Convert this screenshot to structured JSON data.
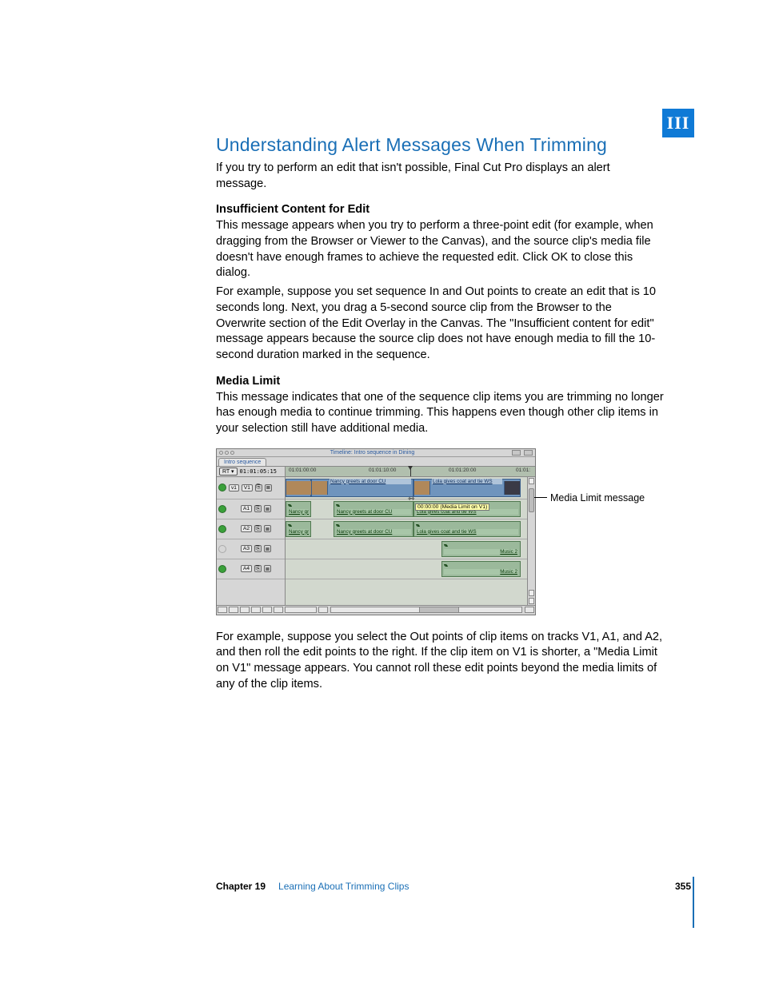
{
  "part_label": "III",
  "heading": "Understanding Alert Messages When Trimming",
  "intro": "If you try to perform an edit that isn't possible, Final Cut Pro displays an alert message.",
  "sub1_title": "Insufficient Content for Edit",
  "sub1_p1": "This message appears when you try to perform a three-point edit (for example, when dragging from the Browser or Viewer to the Canvas), and the source clip's media file doesn't have enough frames to achieve the requested edit. Click OK to close this dialog.",
  "sub1_p2": "For example, suppose you set sequence In and Out points to create an edit that is 10 seconds long. Next, you drag a 5-second source clip from the Browser to the Overwrite section of the Edit Overlay in the Canvas. The \"Insufficient content for edit\" message appears because the source clip does not have enough media to fill the 10-second duration marked in the sequence.",
  "sub2_title": "Media Limit",
  "sub2_p1": "This message indicates that one of the sequence clip items you are trimming no longer has enough media to continue trimming. This happens even though other clip items in your selection still have additional media.",
  "sub2_p2": "For example, suppose you select the Out points of clip items on tracks V1, A1, and A2, and then roll the edit points to the right. If the clip item on V1 is shorter, a \"Media Limit on V1\" message appears. You cannot roll these edit points beyond the media limits of any of the clip items.",
  "callout": "Media Limit message",
  "timeline": {
    "window_title": "Timeline: Intro sequence in Dining",
    "tab": "Intro sequence",
    "rt_label": "RT ▾",
    "timecode": "01:01:05:15",
    "ruler": {
      "t1": "01:01:00:00",
      "t2": "01:01:10:00",
      "t3": "01:01:20:00",
      "t4": "01:01:"
    },
    "tracks": {
      "v1_src": "v1",
      "v1_dst": "V1",
      "a1": "A1",
      "a2": "A2",
      "a3": "A3",
      "a4": "A4"
    },
    "clips": {
      "nancy": "Nancy greets at door CU",
      "nancy_short": "Nancy gre",
      "lola": "Lola gives coat and tie WS",
      "music": "Music 2"
    },
    "tooltip": "00:00:00 (Media Limit on V1)",
    "stereo_marker": "▾▴"
  },
  "footer": {
    "chapter": "Chapter 19",
    "title": "Learning About Trimming Clips",
    "page": "355"
  }
}
